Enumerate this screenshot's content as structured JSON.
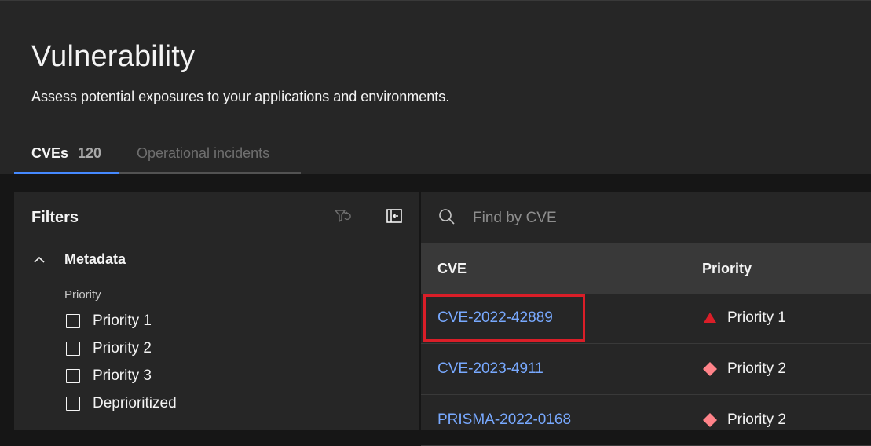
{
  "header": {
    "title": "Vulnerability",
    "subtitle": "Assess potential exposures to your applications and environments."
  },
  "tabs": [
    {
      "label": "CVEs",
      "count": "120",
      "active": true
    },
    {
      "label": "Operational incidents",
      "active": false
    }
  ],
  "filters": {
    "title": "Filters",
    "reset_icon": "filter-reset-icon",
    "collapse_icon": "collapse-panel-icon",
    "section": {
      "label": "Metadata",
      "expanded": true,
      "group_label": "Priority",
      "options": [
        {
          "label": "Priority 1",
          "checked": false
        },
        {
          "label": "Priority 2",
          "checked": false
        },
        {
          "label": "Priority 3",
          "checked": false
        },
        {
          "label": "Deprioritized",
          "checked": false
        }
      ]
    }
  },
  "search": {
    "placeholder": "Find by CVE",
    "value": ""
  },
  "table": {
    "columns": [
      "CVE",
      "Priority"
    ],
    "rows": [
      {
        "cve": "CVE-2022-42889",
        "priority": "Priority 1",
        "priority_icon": "triangle-icon",
        "priority_color": "#da1e28"
      },
      {
        "cve": "CVE-2023-4911",
        "priority": "Priority 2",
        "priority_icon": "diamond-icon",
        "priority_color": "#ff8389"
      },
      {
        "cve": "PRISMA-2022-0168",
        "priority": "Priority 2",
        "priority_icon": "diamond-icon",
        "priority_color": "#ff8389"
      }
    ]
  },
  "colors": {
    "accent": "#4589ff",
    "link": "#78a9ff",
    "highlight": "#da1e28"
  }
}
